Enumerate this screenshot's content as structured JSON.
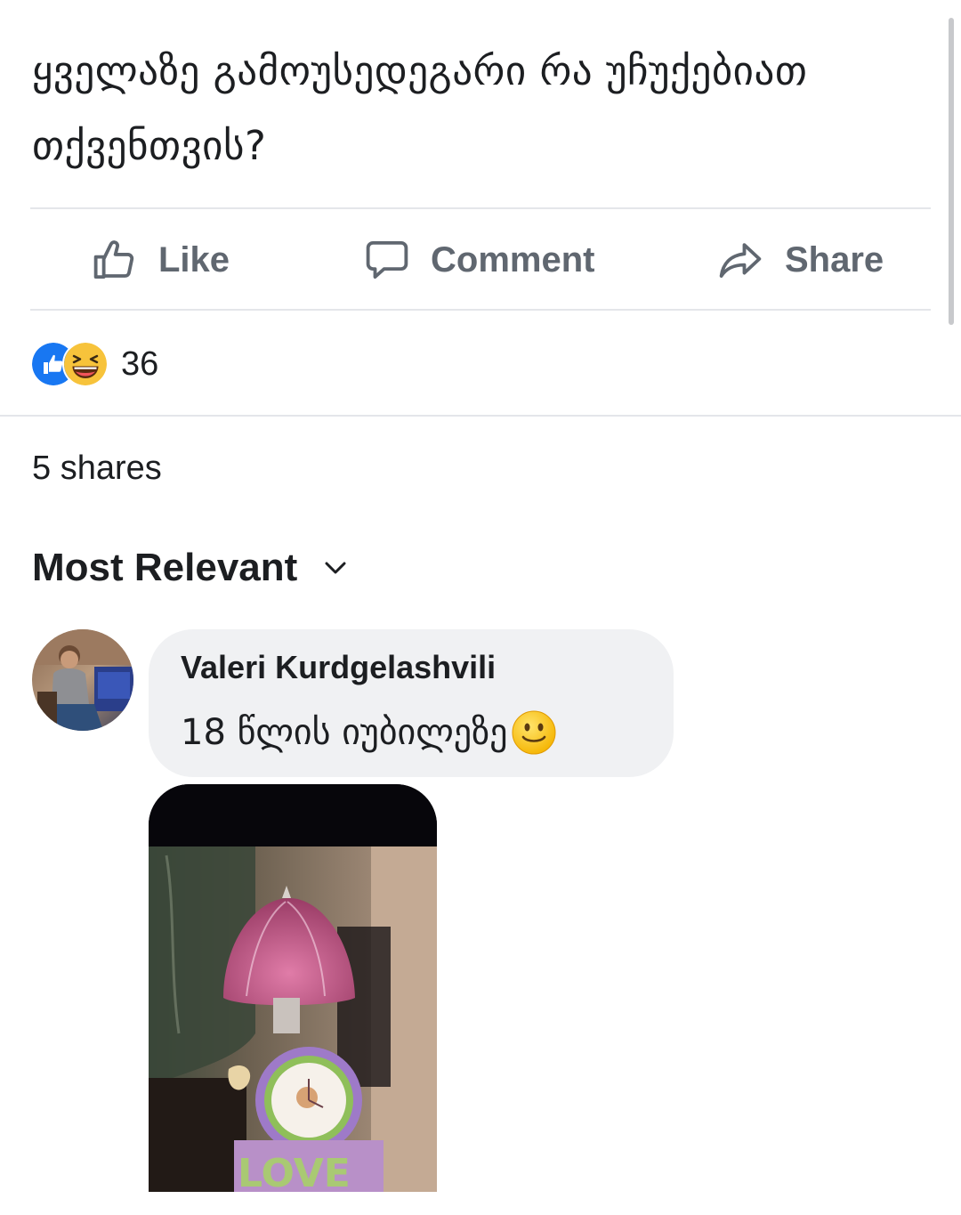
{
  "post": {
    "text": "ყველაზე გამოუსედეგარი რა უჩუქებიათ თქვენთვის?"
  },
  "actions": {
    "like_label": "Like",
    "comment_label": "Comment",
    "share_label": "Share"
  },
  "reactions": {
    "count": "36",
    "types": [
      "like-reaction-icon",
      "haha-reaction-icon"
    ]
  },
  "shares": {
    "label": "5 shares"
  },
  "comments": {
    "sort_label": "Most Relevant",
    "items": [
      {
        "author": "Valeri Kurdgelashvili",
        "text": "18 წლის იუბილეზე",
        "emoji": "slightly-smiling-face-icon"
      }
    ]
  },
  "colors": {
    "text_primary": "#1c1e21",
    "text_secondary": "#606770",
    "bubble_bg": "#f0f1f3",
    "divider": "#e4e6ea",
    "like_blue": "#1877f2",
    "haha_yellow": "#f7c33b"
  }
}
